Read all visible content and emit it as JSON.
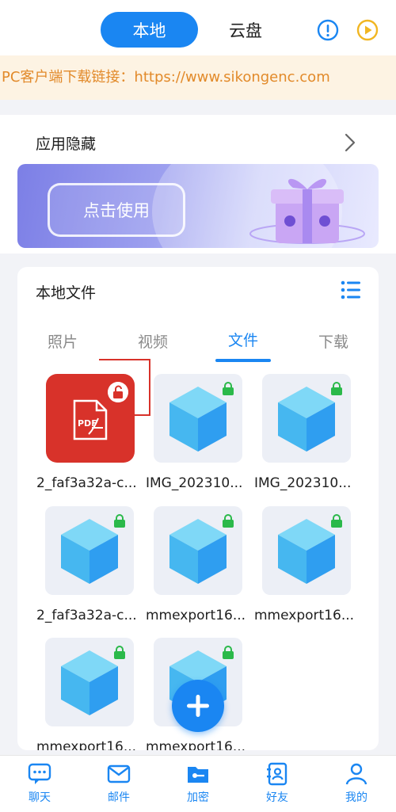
{
  "header": {
    "tab_local": "本地",
    "tab_cloud": "云盘",
    "info_icon": "info-circle-icon",
    "play_icon": "play-circle-icon"
  },
  "banner": {
    "text": "PC客户端下载链接：https://www.sikongenc.com"
  },
  "app_hide": {
    "title": "应用隐藏",
    "promo_button": "点击使用"
  },
  "local_files": {
    "title": "本地文件",
    "tabs": [
      "照片",
      "视频",
      "文件",
      "下载"
    ],
    "active_tab": "文件",
    "files": [
      {
        "name": "2_faf3a32a-c...",
        "type": "pdf",
        "locked": false
      },
      {
        "name": "IMG_202310...",
        "type": "cube",
        "locked": true
      },
      {
        "name": "IMG_202310...",
        "type": "cube",
        "locked": true
      },
      {
        "name": "2_faf3a32a-c...",
        "type": "cube",
        "locked": true
      },
      {
        "name": "mmexport16...",
        "type": "cube",
        "locked": true
      },
      {
        "name": "mmexport16...",
        "type": "cube",
        "locked": true
      },
      {
        "name": "mmexport16...",
        "type": "cube",
        "locked": true
      },
      {
        "name": "mmexport16...",
        "type": "cube",
        "locked": true
      }
    ]
  },
  "bottom_nav": [
    {
      "label": "聊天",
      "icon": "chat-icon"
    },
    {
      "label": "邮件",
      "icon": "mail-icon"
    },
    {
      "label": "加密",
      "icon": "folder-key-icon"
    },
    {
      "label": "好友",
      "icon": "contacts-icon"
    },
    {
      "label": "我的",
      "icon": "person-icon"
    }
  ],
  "colors": {
    "accent": "#1a86f2",
    "banner_text": "#e28a2a",
    "banner_bg": "#fdf3e3",
    "pdf_red": "#d8322a",
    "lock_green": "#2bb94a"
  }
}
